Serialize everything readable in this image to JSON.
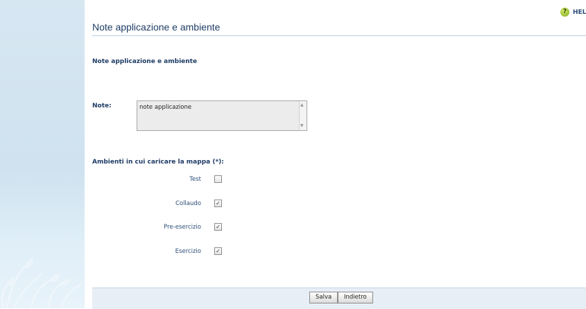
{
  "header": {
    "help_label": "HELP",
    "help_icon": "help-icon",
    "page_title": "Note applicazione e ambiente"
  },
  "form": {
    "section_title": "Note applicazione e ambiente",
    "note_label": "Note:",
    "note_value": "note applicazione",
    "environments_label": "Ambienti in cui caricare la mappa (*):",
    "environments": [
      {
        "label": "Test",
        "checked": false
      },
      {
        "label": "Collaudo",
        "checked": true
      },
      {
        "label": "Pre-esercizio",
        "checked": true
      },
      {
        "label": "Esercizio",
        "checked": true
      }
    ]
  },
  "footer": {
    "save_label": "Salva",
    "back_label": "Indietro"
  },
  "colors": {
    "title": "#1f3c66",
    "sidebar": "#d7e7f2",
    "footer": "#e7eef6"
  }
}
